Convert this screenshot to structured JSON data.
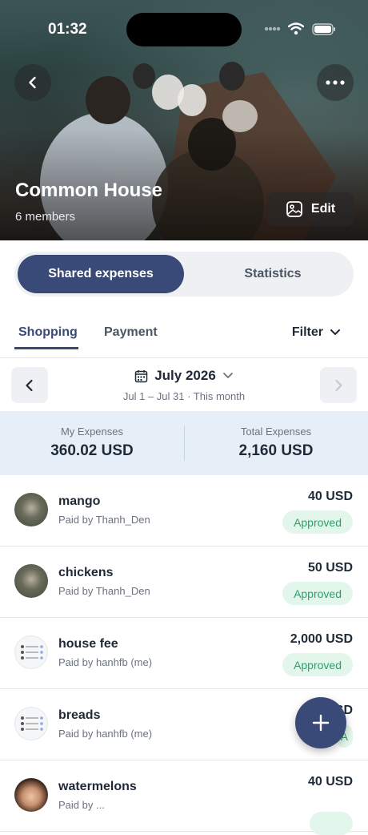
{
  "status_bar": {
    "time": "01:32"
  },
  "header": {
    "title": "Common House",
    "members": "6 members",
    "edit_label": "Edit",
    "icons": {
      "back": "chevron-left-icon",
      "more": "more-dots-icon",
      "edit": "image-icon"
    }
  },
  "segment": {
    "active": "Shared expenses",
    "inactive": "Statistics"
  },
  "tabs": {
    "items": [
      "Shopping",
      "Payment"
    ],
    "active_index": 0,
    "filter_label": "Filter"
  },
  "period": {
    "month": "July 2026",
    "range": "Jul 1 – Jul 31 · This month"
  },
  "summary": {
    "my_label": "My Expenses",
    "my_value": "360.02 USD",
    "total_label": "Total Expenses",
    "total_value": "2,160 USD"
  },
  "expenses": [
    {
      "name": "mango",
      "paid_by": "Paid by Thanh_Den",
      "amount": "40 USD",
      "status": "Approved",
      "avatar": "photo"
    },
    {
      "name": "chickens",
      "paid_by": "Paid by Thanh_Den",
      "amount": "50 USD",
      "status": "Approved",
      "avatar": "photo"
    },
    {
      "name": "house fee",
      "paid_by": "Paid by hanhfb (me)",
      "amount": "2,000 USD",
      "status": "Approved",
      "avatar": "doc"
    },
    {
      "name": "breads",
      "paid_by": "Paid by hanhfb (me)",
      "amount": "SD",
      "status": "A",
      "avatar": "doc"
    },
    {
      "name": "watermelons",
      "paid_by": "Paid by ...",
      "amount": "40 USD",
      "status": "",
      "avatar": "face"
    }
  ],
  "colors": {
    "primary": "#3a4a78",
    "approved_bg": "#e3f6ec",
    "approved_text": "#2f9e6a",
    "summary_bg": "#e6eef8"
  }
}
